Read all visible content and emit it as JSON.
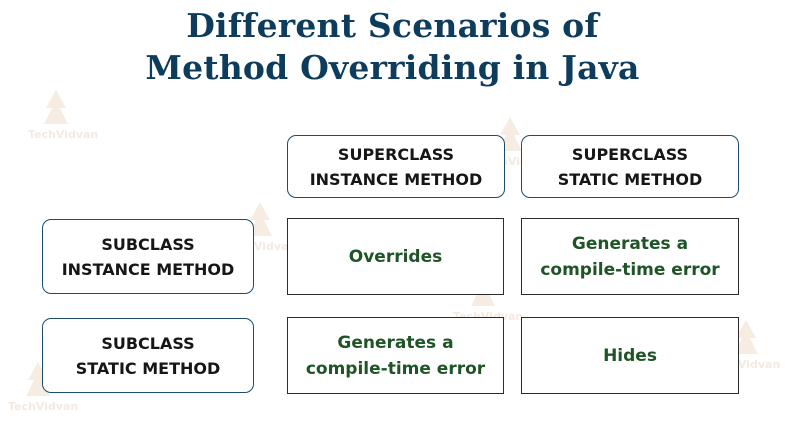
{
  "title": {
    "line1": "Different Scenarios of",
    "line2": "Method Overriding in Java"
  },
  "columns": [
    {
      "line1": "SUPERCLASS",
      "line2": "INSTANCE METHOD"
    },
    {
      "line1": "SUPERCLASS",
      "line2": "STATIC METHOD"
    }
  ],
  "rows": [
    {
      "header": {
        "line1": "SUBCLASS",
        "line2": "INSTANCE METHOD"
      },
      "cells": [
        {
          "line1": "Overrides",
          "line2": ""
        },
        {
          "line1": "Generates a",
          "line2": "compile-time error"
        }
      ]
    },
    {
      "header": {
        "line1": "SUBCLASS",
        "line2": "STATIC METHOD"
      },
      "cells": [
        {
          "line1": "Generates a",
          "line2": "compile-time error"
        },
        {
          "line1": "Hides",
          "line2": ""
        }
      ]
    }
  ],
  "watermark": "TechVidvan",
  "colors": {
    "title": "#0e3c5c",
    "header_border": "#1d4c6c",
    "cell_text": "#1f5526",
    "header_text": "#161616"
  }
}
